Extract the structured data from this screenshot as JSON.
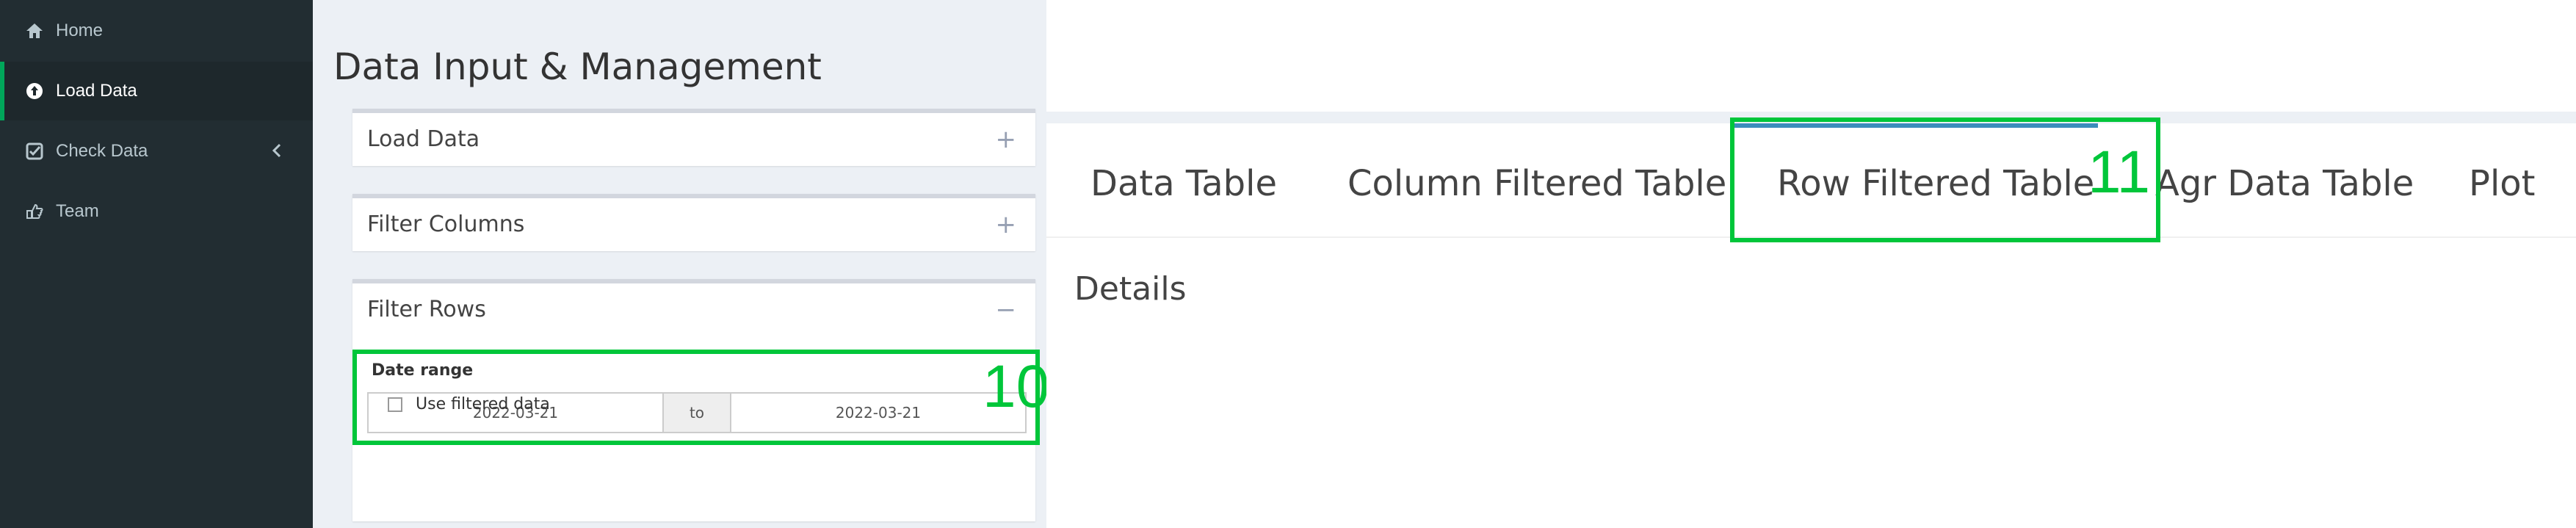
{
  "sidebar": {
    "items": [
      {
        "label": "Home",
        "icon": "home-icon"
      },
      {
        "label": "Load Data",
        "icon": "upload-icon",
        "active": true
      },
      {
        "label": "Check Data",
        "icon": "check-square-icon"
      },
      {
        "label": "Team",
        "icon": "hand-pointer-icon"
      }
    ]
  },
  "page": {
    "title": "Data Input & Management"
  },
  "boxes": {
    "load_data": {
      "title": "Load Data",
      "tool": "+"
    },
    "filter_columns": {
      "title": "Filter Columns",
      "tool": "+"
    },
    "filter_rows": {
      "title": "Filter Rows",
      "tool": "−",
      "date_range_label": "Date range",
      "date_start": "2022-03-21",
      "date_sep": "to",
      "date_end": "2022-03-21",
      "checkbox_label": "Use filtered data"
    }
  },
  "tabs": [
    "Data Table",
    "Column Filtered Table",
    "Row Filtered Table",
    "Agr Data Table",
    "Plot"
  ],
  "active_tab": "Row Filtered Table",
  "details_label": "Details",
  "annotations": [
    "10",
    "11"
  ],
  "colors": {
    "sidebar_bg": "#222d32",
    "accent_green": "#00a65a",
    "annotation": "#00c63a",
    "tab_active": "#3c8dbc"
  }
}
